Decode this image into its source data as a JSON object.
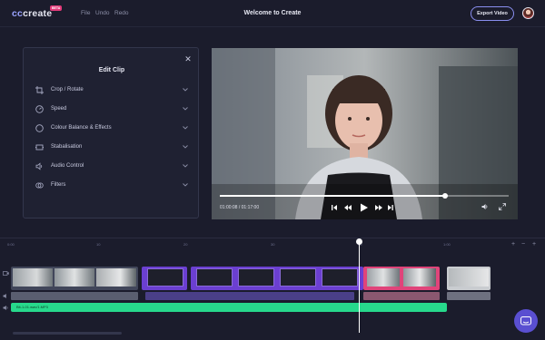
{
  "app": {
    "logo_cc": "cc",
    "logo_create": "create",
    "beta_badge": "BETA",
    "title": "Welcome to Create",
    "menu": [
      {
        "label": "File"
      },
      {
        "label": "Undo"
      },
      {
        "label": "Redo"
      }
    ],
    "export_label": "Export Video"
  },
  "edit_panel": {
    "title": "Edit Clip",
    "items": [
      {
        "label": "Crop / Rotate",
        "icon": "crop-icon"
      },
      {
        "label": "Speed",
        "icon": "speed-icon"
      },
      {
        "label": "Colour Balance & Effects",
        "icon": "colour-icon"
      },
      {
        "label": "Stabalisation",
        "icon": "stabilisation-icon"
      },
      {
        "label": "Audio Control",
        "icon": "audio-icon"
      },
      {
        "label": "Filters",
        "icon": "filters-icon"
      }
    ]
  },
  "player": {
    "time": "01:00:08 / 01:17:00",
    "progress": 0.78
  },
  "timeline": {
    "ruler_ticks": [
      "0:00",
      "10",
      "20",
      "30",
      "40",
      "1:00"
    ],
    "audio_label": "Bit-1-01.wav/1.MP3"
  },
  "colors": {
    "accent": "#8a8ff0",
    "clip_purple": "#6b3fd1",
    "clip_pink": "#e0447a",
    "audio_green": "#27d98c"
  }
}
